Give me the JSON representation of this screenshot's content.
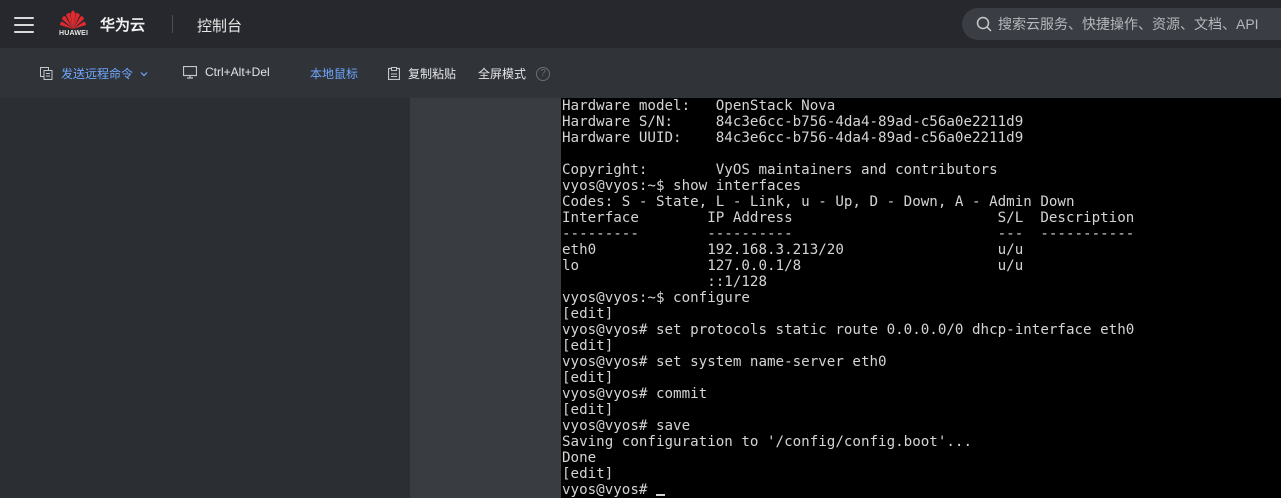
{
  "header": {
    "logo_text": "HUAWEI",
    "brand": "华为云",
    "console": "控制台",
    "search_placeholder": "搜索云服务、快捷操作、资源、文档、API"
  },
  "toolbar": {
    "send_command": "发送远程命令",
    "ctrl_alt_del": "Ctrl+Alt+Del",
    "local_mouse": "本地鼠标",
    "copy_paste": "复制粘贴",
    "fullscreen": "全屏模式",
    "help": "?"
  },
  "terminal": {
    "lines": [
      "Hardware model:   OpenStack Nova",
      "Hardware S/N:     84c3e6cc-b756-4da4-89ad-c56a0e2211d9",
      "Hardware UUID:    84c3e6cc-b756-4da4-89ad-c56a0e2211d9",
      "",
      "Copyright:        VyOS maintainers and contributors",
      "vyos@vyos:~$ show interfaces",
      "Codes: S - State, L - Link, u - Up, D - Down, A - Admin Down",
      "Interface        IP Address                        S/L  Description",
      "---------        ----------                        ---  -----------",
      "eth0             192.168.3.213/20                  u/u",
      "lo               127.0.0.1/8                       u/u",
      "                 ::1/128",
      "vyos@vyos:~$ configure",
      "[edit]",
      "vyos@vyos# set protocols static route 0.0.0.0/0 dhcp-interface eth0",
      "[edit]",
      "vyos@vyos# set system name-server eth0",
      "[edit]",
      "vyos@vyos# commit",
      "[edit]",
      "vyos@vyos# save",
      "Saving configuration to '/config/config.boot'...",
      "Done",
      "[edit]"
    ],
    "prompt": "vyos@vyos# "
  },
  "colors": {
    "accent": "#6fa8ff",
    "header_bg": "#26282d",
    "toolbar_bg": "#303338",
    "terminal_bg": "#000000"
  },
  "icons": [
    "menu-icon",
    "huawei-logo-icon",
    "search-icon",
    "command-icon",
    "monitor-icon",
    "clipboard-icon",
    "chevron-down-icon"
  ]
}
